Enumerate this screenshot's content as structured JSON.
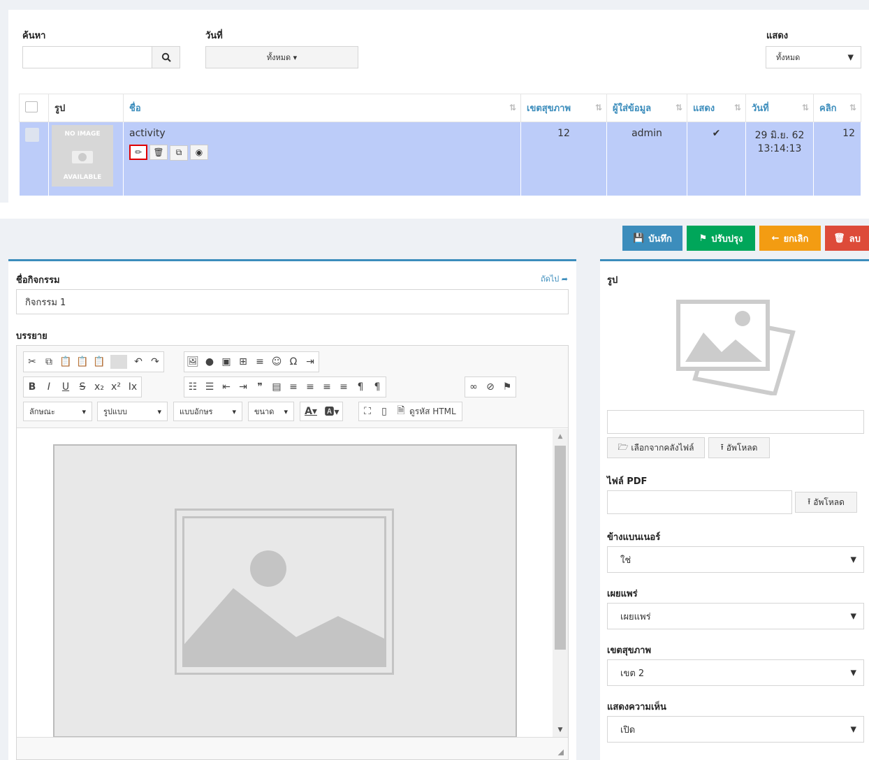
{
  "list": {
    "search_label": "ค้นหา",
    "date_label": "วันที่",
    "date_button": "ทั้งหมด ▾",
    "show_label": "แสดง",
    "show_select": "ทั้งหมด",
    "columns": [
      "รูป",
      "ชื่อ",
      "เขตสุขภาพ",
      "ผู้ใส่ข้อมูล",
      "แสดง",
      "วันที่",
      "คลิก"
    ],
    "row": {
      "no_image_top": "NO IMAGE",
      "no_image_bottom": "AVAILABLE",
      "name": "activity",
      "region": "12",
      "author": "admin",
      "shown": "✔",
      "date_line1": "29 มิ.ย. 62",
      "date_line2": "13:14:13",
      "clicks": "12"
    }
  },
  "toolbar": {
    "save": "บันทึก",
    "update": "ปรับปรุง",
    "cancel": "ยกเลิก",
    "delete": "ลบ"
  },
  "form": {
    "activity_name_label": "ชื่อกิจกรรม",
    "next_link": "ถัดไป",
    "activity_name_value": "กิจกรรม 1",
    "description_label": "บรรยาย",
    "editor": {
      "style_dd": "ลักษณะ",
      "format_dd": "รูปแบบ",
      "font_dd": "แบบอักษร",
      "size_dd": "ขนาด",
      "source_button": "ดูรหัส HTML"
    },
    "image_label": "รูป",
    "choose_from_library": "เลือกจากคลังไฟล์",
    "upload": "อัพโหลด",
    "pdf_label": "ไฟล์ PDF",
    "pdf_upload": "อัพโหลด",
    "banner_label": "ข้างแบนเนอร์",
    "banner_value": "ใช่",
    "publish_label": "เผยแพร่",
    "publish_value": "เผยแพร่",
    "region_label": "เขตสุขภาพ",
    "region_value": "เขต 2",
    "comments_label": "แสดงความเห็น",
    "comments_value": "เปิด"
  },
  "colors": {
    "save": "#3c8dbc",
    "update": "#00a65a",
    "cancel": "#f39c12",
    "delete": "#dd4b39",
    "row_highlight": "#bcccf9"
  }
}
